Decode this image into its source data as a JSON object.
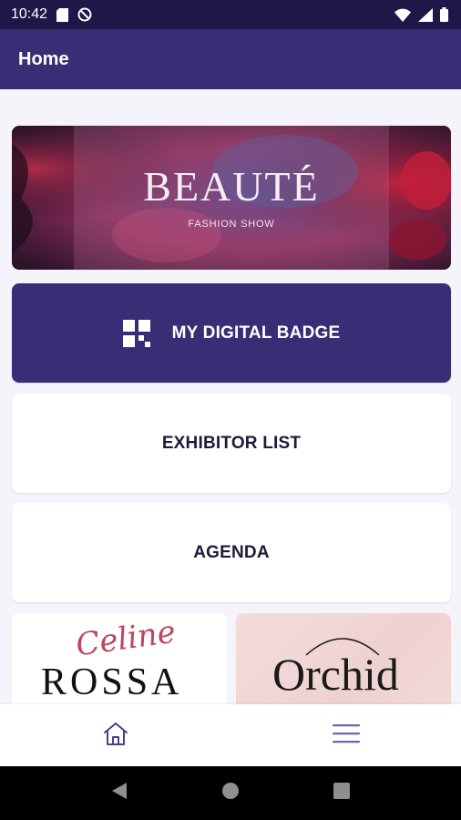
{
  "status_bar": {
    "time": "10:42"
  },
  "app_bar": {
    "title": "Home"
  },
  "banner": {
    "title": "BEAUTÉ",
    "subtitle": "FASHION SHOW"
  },
  "tiles": {
    "badge": "MY DIGITAL BADGE",
    "exhibitor": "EXHIBITOR LIST",
    "agenda": "AGENDA"
  },
  "logos": {
    "celine_script": "Celine",
    "rossa": "ROSSA",
    "orchid": "Orchid"
  },
  "colors": {
    "primary": "#3a2d76",
    "status_bar": "#1f1748",
    "background": "#f6f4fb"
  },
  "bottom_nav": {
    "home_icon": "home-icon",
    "menu_icon": "menu-icon"
  }
}
